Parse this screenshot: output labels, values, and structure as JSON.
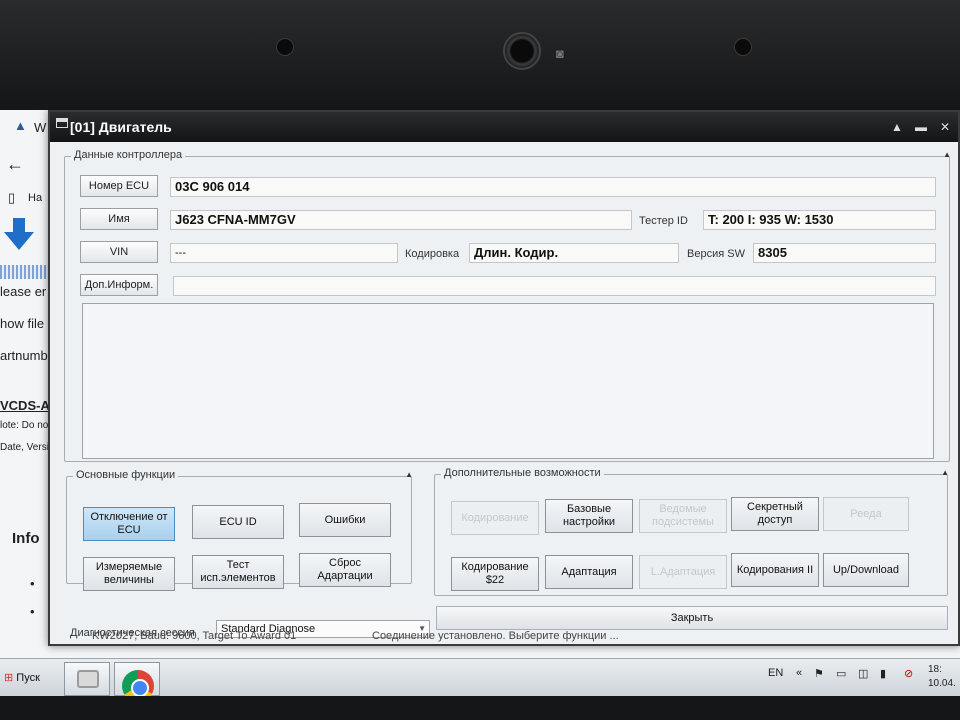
{
  "dialog": {
    "title": "[01] Двигатель",
    "controller_group_label": "Данные контроллера",
    "ecu_number_label": "Номер ECU",
    "ecu_number_value": "03C 906 014",
    "name_label": "Имя",
    "name_value": "J623 CFNA-MM7GV",
    "tester_id_label": "Тестер ID",
    "tester_id_value": "T: 200 I: 935 W: 1530",
    "vin_label": "VIN",
    "vin_value": "---",
    "coding_label": "Кодировка",
    "coding_value": "Длин. Кодир.",
    "sw_version_label": "Версия SW",
    "sw_version_value": "8305",
    "extra_info_label": "Доп.Информ.",
    "extra_info_value": "",
    "basic_group_label": "Основные функции",
    "basic_buttons": [
      {
        "label": "Отключение от ECU"
      },
      {
        "label": "ECU ID"
      },
      {
        "label": "Ошибки"
      },
      {
        "label": "Измеряемые величины"
      },
      {
        "label": "Тест исп.элементов"
      },
      {
        "label": "Сброс Адартации"
      }
    ],
    "extra_group_label": "Дополнительные возможности",
    "extra_buttons": [
      {
        "label": "Кодирование"
      },
      {
        "label": "Базовые настройки"
      },
      {
        "label": "Ведомые подсистемы"
      },
      {
        "label": "Секретный доступ"
      },
      {
        "label": "Рееда"
      },
      {
        "label": "Кодирование $22"
      },
      {
        "label": "Адаптация"
      },
      {
        "label": "L.Адаптация"
      },
      {
        "label": "Кодирования II"
      },
      {
        "label": "Up/Download"
      }
    ],
    "diag_session_label": "Диагностическая сессия",
    "diag_session_value": "Standard Diagnose",
    "close_label": "Закрыть",
    "status_left": "KW2027, Baud: 9600, Target To Award 01",
    "status_right": "Соединение установлено. Выберите функции ..."
  },
  "background": {
    "lines": [
      "W",
      "Ha",
      "lease er",
      "how file",
      "artnumb",
      "VCDS-Au",
      "lote: Do no",
      "Date, Versio",
      "Info"
    ]
  },
  "taskbar": {
    "start_label": "Пуск",
    "lang": "EN",
    "clock_time": "18:",
    "clock_date": "10.04."
  },
  "colors": {
    "active_button": "#a9d0ee",
    "titlebar": "#131415",
    "dialog_bg": "#eef1f4"
  }
}
